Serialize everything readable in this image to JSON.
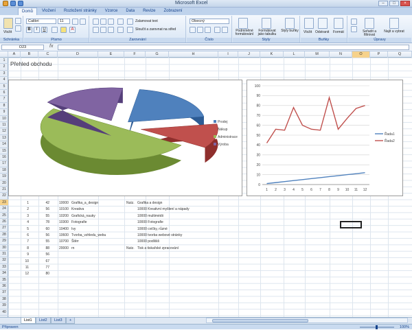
{
  "app": {
    "title": "Microsoft Excel",
    "tabs": [
      "Domů",
      "Vložení",
      "Rozložení stránky",
      "Vzorce",
      "Data",
      "Revize",
      "Zobrazení"
    ],
    "active_tab": "Domů"
  },
  "ribbon": {
    "paste_label": "Vložit",
    "font_name": "Calibri",
    "font_size": "11",
    "wrap_text": "Zalamovat text",
    "merge_center": "Sloučit a zarovnat na střed",
    "number_format": "Obecný",
    "conditional_format": "Podmíněné formátování",
    "format_as_table": "Formátovat jako tabulku",
    "cell_styles": "Styly buňky",
    "insert": "Vložit",
    "delete": "Odstranit",
    "format": "Formát",
    "sort_filter": "Seřadit a filtrovat",
    "find_select": "Najít a vybrat",
    "groups": [
      "Schránka",
      "Písmo",
      "Zarovnání",
      "Číslo",
      "Styly",
      "Buňky",
      "Úpravy"
    ]
  },
  "formula_bar": {
    "name_box": "O23",
    "fx": "fx",
    "value": ""
  },
  "columns": [
    "A",
    "B",
    "C",
    "D",
    "E",
    "F",
    "G",
    "H",
    "I",
    "J",
    "K",
    "L",
    "M",
    "N",
    "O",
    "P",
    "Q"
  ],
  "selected_column": "O",
  "rows": [
    "1",
    "2",
    "3",
    "4",
    "5",
    "6",
    "7",
    "8",
    "9",
    "10",
    "11",
    "12",
    "13",
    "14",
    "15",
    "16",
    "17",
    "18",
    "19",
    "20",
    "21",
    "22",
    "23",
    "24",
    "25",
    "26",
    "27",
    "28",
    "29",
    "30",
    "31",
    "32",
    "33",
    "34",
    "35",
    "36",
    "37",
    "38",
    "39",
    "40"
  ],
  "selected_row": "23",
  "sheet_title": "Přehled obchodu",
  "table": {
    "rows": [
      {
        "b": "1",
        "c": "42",
        "d": "10000",
        "e": "Grafika_a_design",
        "g": "Nutz.",
        "h": "Grafika a design"
      },
      {
        "b": "2",
        "c": "56",
        "d": "10100",
        "e": "Kreativa",
        "g": "",
        "h": "10000  Kreativní myšlení a nápady"
      },
      {
        "b": "3",
        "c": "55",
        "d": "10200",
        "e": "Grafická_nauky",
        "g": "",
        "h": "10000  multimédii"
      },
      {
        "b": "4",
        "c": "78",
        "d": "10300",
        "e": "Fotografie",
        "g": "",
        "h": "10000  Fotografie"
      },
      {
        "b": "5",
        "c": "60",
        "d": "10400",
        "e": "Ivy",
        "g": "",
        "h": "10000  cvičky, různé"
      },
      {
        "b": "6",
        "c": "56",
        "d": "10600",
        "e": "Tvorba_vzhledu_webu",
        "g": "",
        "h": "10000  tvorba webové stránky"
      },
      {
        "b": "7",
        "c": "55",
        "d": "10700",
        "e": "Štěrr",
        "g": "",
        "h": "10000  podlišiš"
      },
      {
        "b": "8",
        "c": "88",
        "d": "20000",
        "e": "rn",
        "g": "Nutz.",
        "h": "Tisk a tiskařské zpracování"
      },
      {
        "b": "9",
        "c": "56",
        "d": "",
        "e": "",
        "g": "",
        "h": ""
      },
      {
        "b": "10",
        "c": "67",
        "d": "",
        "e": "",
        "g": "",
        "h": ""
      },
      {
        "b": "11",
        "c": "77",
        "d": "",
        "e": "",
        "g": "",
        "h": ""
      },
      {
        "b": "12",
        "c": "80",
        "d": "",
        "e": "",
        "g": "",
        "h": ""
      }
    ]
  },
  "sheet_tabs": [
    "List1",
    "List2",
    "List3"
  ],
  "active_sheet": "List1",
  "status": {
    "text": "Připraven",
    "zoom": "100%"
  },
  "colors": {
    "pie_blue": "#4f81bd",
    "pie_red": "#c0504d",
    "pie_green": "#9bbb59",
    "pie_purple": "#8064a2",
    "line_blue": "#4f81bd",
    "line_red": "#c0504d"
  },
  "chart_data": [
    {
      "type": "pie",
      "title": "",
      "categories": [
        "Prodej",
        "Nákup",
        "Administrace",
        "Výroba"
      ],
      "values": [
        20,
        12,
        50,
        18
      ],
      "legend": "right"
    },
    {
      "type": "line",
      "title": "",
      "x": [
        1,
        2,
        3,
        4,
        5,
        6,
        7,
        8,
        9,
        10,
        11,
        12
      ],
      "series": [
        {
          "name": "Řada1",
          "values": [
            1,
            2,
            3,
            4,
            5,
            6,
            7,
            8,
            9,
            10,
            11,
            12
          ]
        },
        {
          "name": "Řada2",
          "values": [
            42,
            56,
            55,
            78,
            60,
            56,
            55,
            88,
            56,
            67,
            77,
            80
          ]
        }
      ],
      "ylim": [
        0,
        100
      ],
      "yticks": [
        0,
        10,
        20,
        30,
        40,
        50,
        60,
        70,
        80,
        90,
        100
      ],
      "xticks": [
        1,
        2,
        3,
        4,
        5,
        6,
        7,
        8,
        9,
        10,
        11,
        12
      ],
      "grid": true,
      "legend": "right"
    }
  ]
}
